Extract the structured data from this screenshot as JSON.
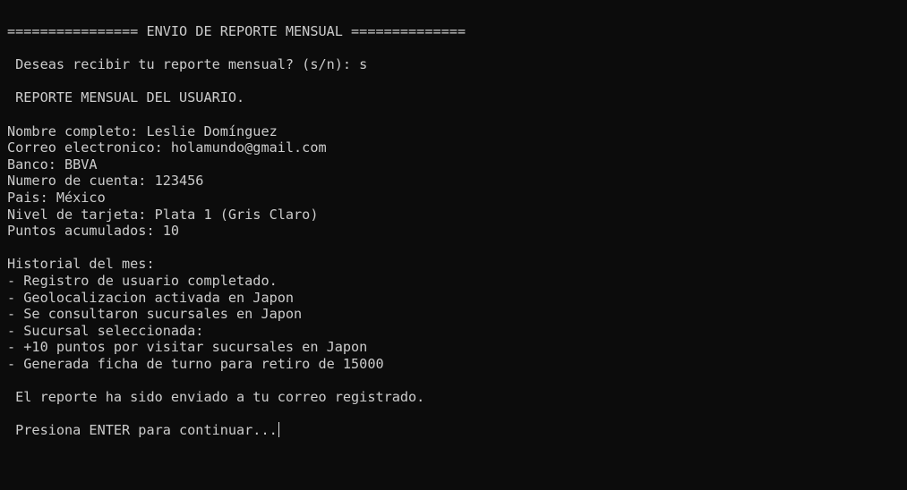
{
  "terminal": {
    "header": "================ ENVIO DE REPORTE MENSUAL ==============",
    "prompt": " Deseas recibir tu reporte mensual? (s/n): s",
    "report_title": " REPORTE MENSUAL DEL USUARIO.",
    "fields": [
      "Nombre completo: Leslie Domínguez",
      "Correo electronico: holamundo@gmail.com",
      "Banco: BBVA",
      "Numero de cuenta: 123456",
      "Pais: México",
      "Nivel de tarjeta: Plata 1 (Gris Claro)",
      "Puntos acumulados: 10"
    ],
    "history_title": "Historial del mes:",
    "history": [
      "- Registro de usuario completado.",
      "- Geolocalizacion activada en Japon",
      "- Se consultaron sucursales en Japon",
      "- Sucursal seleccionada:",
      "- +10 puntos por visitar sucursales en Japon",
      "- Generada ficha de turno para retiro de 15000"
    ],
    "sent_message": " El reporte ha sido enviado a tu correo registrado.",
    "continue_prompt": " Presiona ENTER para continuar..."
  },
  "colors": {
    "background": "#0c0c0c",
    "text": "#cccccc"
  }
}
